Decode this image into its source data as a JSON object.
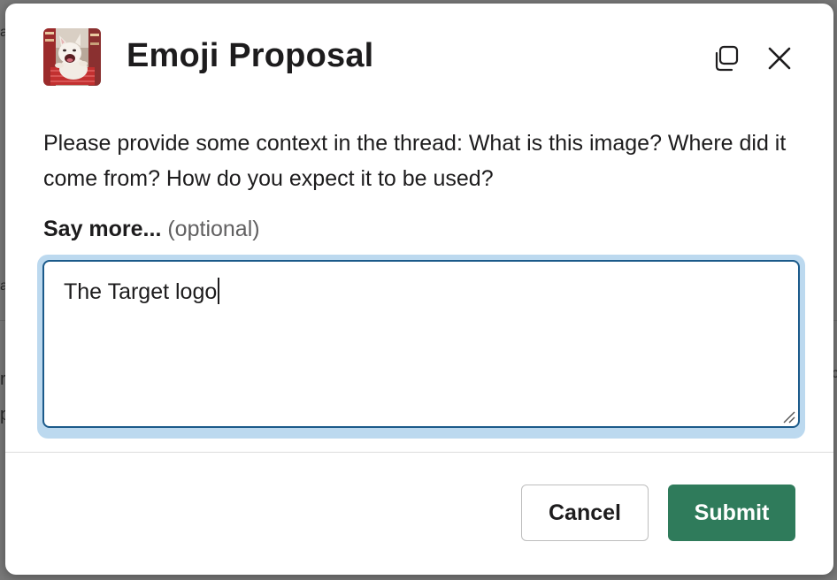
{
  "modal": {
    "title": "Emoji Proposal",
    "description": "Please provide some context in the thread: What is this image? Where did it come from? How do you expect it to be used?",
    "field": {
      "label": "Say more...",
      "optional_hint": "(optional)",
      "value": "The Target logo"
    },
    "buttons": {
      "cancel_label": "Cancel",
      "submit_label": "Submit"
    },
    "icons": {
      "thumbnail": "emoji-preview-image",
      "copy": "copy-icon",
      "close": "close-icon"
    }
  },
  "colors": {
    "submit_bg": "#2f7b5b",
    "focus_ring": "#bcd9ef",
    "field_border": "#1b5a8a",
    "text": "#1d1c1d",
    "muted_text": "#616061"
  }
}
